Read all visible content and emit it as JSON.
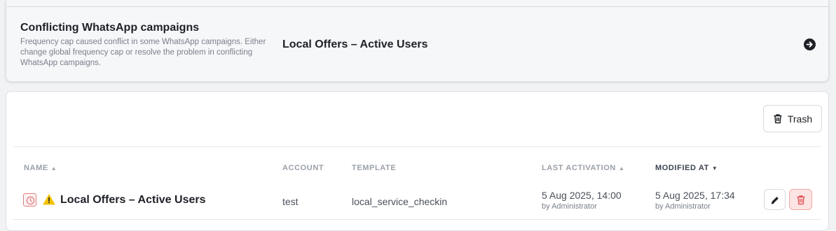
{
  "conflict": {
    "title": "Conflicting WhatsApp campaigns",
    "description": "Frequency cap caused conflict in some WhatsApp campaigns. Either change global frequency cap or resolve the problem in conflicting WhatsApp campaigns.",
    "campaign_name": "Local Offers – Active Users",
    "arrow_icon": "arrow-right-circle-icon"
  },
  "toolbar": {
    "trash_label": "Trash",
    "trash_icon": "trash-icon"
  },
  "table": {
    "columns": {
      "name": "NAME",
      "account": "ACCOUNT",
      "template": "TEMPLATE",
      "last_activation": "LAST ACTIVATION",
      "modified_at": "MODIFIED AT"
    },
    "sort": {
      "name": "▲",
      "last_activation": "▲",
      "modified_at": "▼"
    },
    "rows": [
      {
        "status_icon": "clock-icon",
        "warning_icon": "warning-icon",
        "name": "Local Offers – Active Users",
        "account": "test",
        "template": "local_service_checkin",
        "last_activation": "5 Aug 2025, 14:00",
        "last_activation_by": "by Administrator",
        "modified_at": "5 Aug 2025, 17:34",
        "modified_by": "by Administrator"
      }
    ]
  },
  "colors": {
    "danger": "#e05555",
    "warning": "#f2c200",
    "text": "#1d2026"
  }
}
